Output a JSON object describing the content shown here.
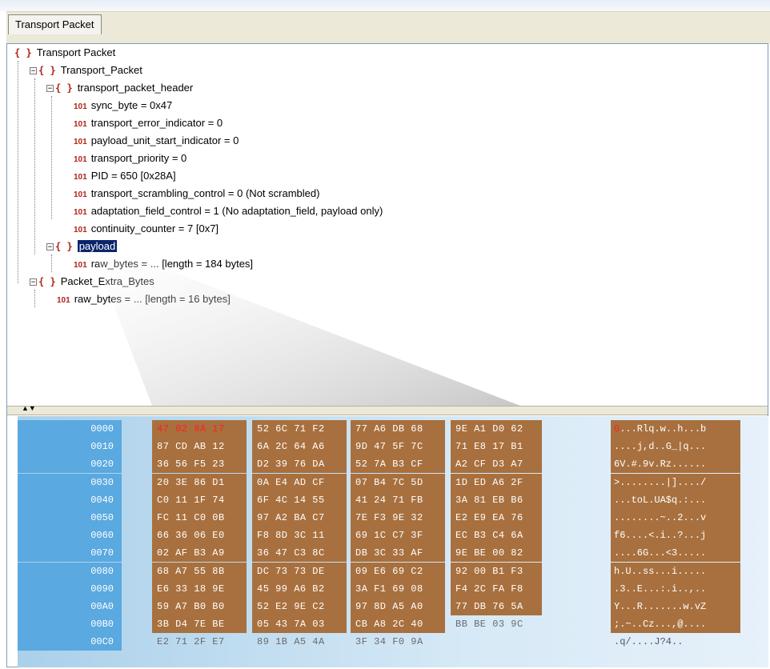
{
  "tab": {
    "label": "Transport Packet"
  },
  "tree": [
    {
      "indent": 0,
      "kind": "brace",
      "expander": "",
      "label": "Transport Packet"
    },
    {
      "indent": 1,
      "kind": "brace",
      "expander": "−",
      "label": "Transport_Packet"
    },
    {
      "indent": 2,
      "kind": "brace",
      "expander": "−",
      "label": "transport_packet_header"
    },
    {
      "indent": 3,
      "kind": "num",
      "expander": "",
      "label": "sync_byte = 0x47"
    },
    {
      "indent": 3,
      "kind": "num",
      "expander": "",
      "label": "transport_error_indicator = 0"
    },
    {
      "indent": 3,
      "kind": "num",
      "expander": "",
      "label": "payload_unit_start_indicator = 0"
    },
    {
      "indent": 3,
      "kind": "num",
      "expander": "",
      "label": "transport_priority = 0"
    },
    {
      "indent": 3,
      "kind": "num",
      "expander": "",
      "label": "PID = 650 [0x28A]"
    },
    {
      "indent": 3,
      "kind": "num",
      "expander": "",
      "label": "transport_scrambling_control = 0 (Not scrambled)"
    },
    {
      "indent": 3,
      "kind": "num",
      "expander": "",
      "label": "adaptation_field_control = 1 (No adaptation_field, payload only)"
    },
    {
      "indent": 3,
      "kind": "num",
      "expander": "",
      "label": "continuity_counter = 7 [0x7]"
    },
    {
      "indent": 2,
      "kind": "brace",
      "expander": "−",
      "label": "payload",
      "selected": true
    },
    {
      "indent": 3,
      "kind": "num",
      "expander": "",
      "label": "raw_bytes = ... [length = 184 bytes]"
    },
    {
      "indent": 1,
      "kind": "brace",
      "expander": "−",
      "label": "Packet_Extra_Bytes"
    },
    {
      "indent": 2,
      "kind": "num",
      "expander": "",
      "label": "raw_bytes = ... [length = 16 bytes]"
    }
  ],
  "icons": {
    "brace": "{ }",
    "num": "101",
    "splitter": "▲▼"
  },
  "hex": [
    {
      "addr": "0000",
      "g": [
        "47 02 8A 17",
        "52 6C 71 F2",
        "77 A6 DB 68",
        "9E A1 D0 62"
      ],
      "ascii": "G...Rlq.w..h...b"
    },
    {
      "addr": "0010",
      "g": [
        "87 CD AB 12",
        "6A 2C 64 A6",
        "9D 47 5F 7C",
        "71 E8 17 B1"
      ],
      "ascii": "....j,d..G_|q..."
    },
    {
      "addr": "0020",
      "g": [
        "36 56 F5 23",
        "D2 39 76 DA",
        "52 7A B3 CF",
        "A2 CF D3 A7"
      ],
      "ascii": "6V.#.9v.Rz......"
    },
    {
      "addr": "0030",
      "g": [
        "20 3E 86 D1",
        "0A E4 AD CF",
        "07 B4 7C 5D",
        "1D ED A6 2F"
      ],
      "ascii": " >........|]..../"
    },
    {
      "addr": "0040",
      "g": [
        "C0 11 1F 74",
        "6F 4C 14 55",
        "41 24 71 FB",
        "3A 81 EB B6"
      ],
      "ascii": "...toL.UA$q.:..."
    },
    {
      "addr": "0050",
      "g": [
        "FC 11 C0 0B",
        "97 A2 BA C7",
        "7E F3 9E 32",
        "E2 E9 EA 76"
      ],
      "ascii": "........~..2...v"
    },
    {
      "addr": "0060",
      "g": [
        "66 36 06 E0",
        "F8 8D 3C 11",
        "69 1C C7 3F",
        "EC B3 C4 6A"
      ],
      "ascii": "f6....<.i..?...j"
    },
    {
      "addr": "0070",
      "g": [
        "02 AF B3 A9",
        "36 47 C3 8C",
        "DB 3C 33 AF",
        "9E BE 00 82"
      ],
      "ascii": "....6G...<3....."
    },
    {
      "addr": "0080",
      "g": [
        "68 A7 55 8B",
        "DC 73 73 DE",
        "09 E6 69 C2",
        "92 00 B1 F3"
      ],
      "ascii": "h.U..ss...i....."
    },
    {
      "addr": "0090",
      "g": [
        "E6 33 18 9E",
        "45 99 A6 B2",
        "3A F1 69 08",
        "F4 2C FA F8"
      ],
      "ascii": ".3..E...:.i..,.."
    },
    {
      "addr": "00A0",
      "g": [
        "59 A7 B0 B0",
        "52 E2 9E C2",
        "97 8D A5 A0",
        "77 DB 76 5A"
      ],
      "ascii": "Y...R.......w.vZ"
    },
    {
      "addr": "00B0",
      "g": [
        "3B D4 7E BE",
        "05 43 7A 03",
        "CB A8 2C 40",
        "BB BE 03 9C"
      ],
      "ascii": ";.~..Cz...,@...."
    },
    {
      "addr": "00C0",
      "g": [
        "E2 71 2F E7",
        "89 1B A5 4A",
        "3F 34 F0 9A",
        ""
      ],
      "ascii": ".q/....J?4.."
    }
  ]
}
